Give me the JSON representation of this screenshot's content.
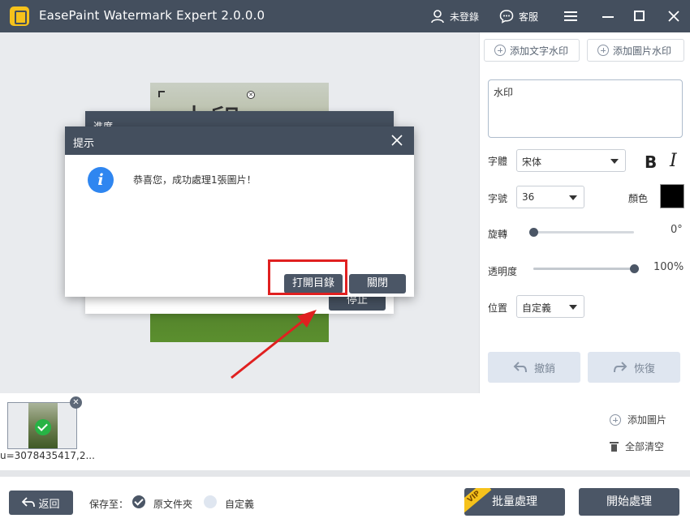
{
  "titlebar": {
    "app_title": "EasePaint Watermark Expert  2.0.0.0",
    "user_label": "未登錄",
    "service_label": "客服"
  },
  "canvas": {
    "watermark_preview_text": "水印",
    "progress_dialog": {
      "title": "進度",
      "stop_label": "停止"
    },
    "prompt_dialog": {
      "title": "提示",
      "message": "恭喜您，成功處理1張圖片！",
      "open_dir_label": "打開目錄",
      "close_label": "關閉"
    }
  },
  "right_panel": {
    "add_text_watermark": "添加文字水印",
    "add_image_watermark": "添加圖片水印",
    "watermark_text": "水印",
    "font_label": "字體",
    "font_value": "宋体",
    "size_label": "字號",
    "size_value": "36",
    "color_label": "顏色",
    "color_value": "#000000",
    "rotation_label": "旋轉",
    "rotation_value": "0°",
    "rotation_fraction": 0.0,
    "opacity_label": "透明度",
    "opacity_value": "100%",
    "opacity_fraction": 1.0,
    "position_label": "位置",
    "position_value": "自定義",
    "undo_label": "撤銷",
    "redo_label": "恢復"
  },
  "strip": {
    "file_name": "u=3078435417,2...",
    "add_image_label": "添加圖片",
    "clear_all_label": "全部清空"
  },
  "bottombar": {
    "back_label": "返回",
    "save_to_label": "保存至：",
    "option_original": "原文件夾",
    "option_custom": "自定義",
    "vip_tag": "VIP",
    "batch_label": "批量處理",
    "start_label": "開始處理"
  },
  "colors": {
    "titlebar_bg": "#444f5e",
    "button_dark": "#4b5666",
    "info_blue": "#2f86f0",
    "success_green": "#27b345",
    "highlight_red": "#e02020",
    "vip_yellow": "#f6c21b"
  }
}
